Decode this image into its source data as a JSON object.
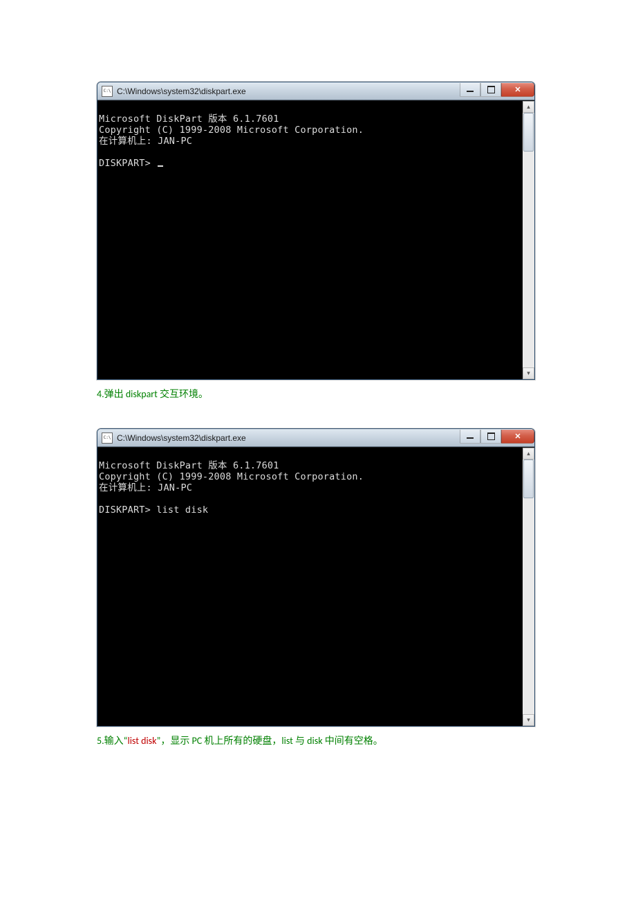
{
  "colors": {
    "caption_green": "#008000",
    "caption_red": "#c00000"
  },
  "win1": {
    "title": "C:\\Windows\\system32\\diskpart.exe",
    "lines": {
      "l1": "Microsoft DiskPart 版本 6.1.7601",
      "l2": "Copyright (C) 1999-2008 Microsoft Corporation.",
      "l3": "在计算机上: JAN-PC",
      "blank": "",
      "prompt": "DISKPART> "
    }
  },
  "caption1": {
    "num_label": "4.",
    "text_a": "弹出 ",
    "text_b": "diskpart",
    "text_c": " 交互环境。"
  },
  "win2": {
    "title": "C:\\Windows\\system32\\diskpart.exe",
    "lines": {
      "l1": "Microsoft DiskPart 版本 6.1.7601",
      "l2": "Copyright (C) 1999-2008 Microsoft Corporation.",
      "l3": "在计算机上: JAN-PC",
      "blank": "",
      "prompt": "DISKPART> list disk"
    }
  },
  "caption2": {
    "num_label": "5.",
    "text_a": "输入“",
    "cmd": "list disk",
    "text_b": "”，显示 PC 机上所有的硬盘，list 与 disk 中间有空格。"
  }
}
